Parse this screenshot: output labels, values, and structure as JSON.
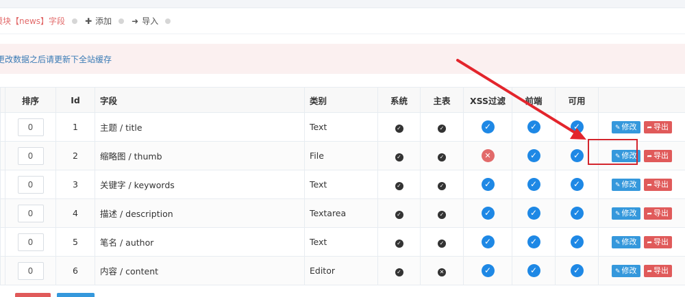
{
  "tabs": [
    {
      "label": "模块【news】字段",
      "active": true,
      "icon": ""
    },
    {
      "label": "添加",
      "active": false,
      "icon": "plus-icon"
    },
    {
      "label": "导入",
      "active": false,
      "icon": "sign-in-icon"
    }
  ],
  "alert": {
    "text": "更改数据之后请更新下全站缓存"
  },
  "table": {
    "headers": [
      "排序",
      "Id",
      "字段",
      "类别",
      "系统",
      "主表",
      "XSS过滤",
      "前端",
      "可用"
    ],
    "edit_label": "修改",
    "export_label": "导出",
    "rows": [
      {
        "order": "0",
        "id": "1",
        "field": "主题 / title",
        "type": "Text",
        "system": true,
        "main": true,
        "xss": true,
        "front": true,
        "enabled": true
      },
      {
        "order": "0",
        "id": "2",
        "field": "缩略图 / thumb",
        "type": "File",
        "system": true,
        "main": true,
        "xss": false,
        "front": true,
        "enabled": true
      },
      {
        "order": "0",
        "id": "3",
        "field": "关键字 / keywords",
        "type": "Text",
        "system": true,
        "main": true,
        "xss": true,
        "front": true,
        "enabled": true
      },
      {
        "order": "0",
        "id": "4",
        "field": "描述 / description",
        "type": "Textarea",
        "system": true,
        "main": true,
        "xss": true,
        "front": true,
        "enabled": true
      },
      {
        "order": "0",
        "id": "5",
        "field": "笔名 / author",
        "type": "Text",
        "system": true,
        "main": true,
        "xss": true,
        "front": true,
        "enabled": true
      },
      {
        "order": "0",
        "id": "6",
        "field": "内容 / content",
        "type": "Editor",
        "system": true,
        "main": false,
        "xss": true,
        "front": true,
        "enabled": true
      }
    ]
  },
  "colors": {
    "primary": "#3598dc",
    "danger": "#e05a5a",
    "highlight": "#d3242c",
    "check": "#1e88e5"
  }
}
